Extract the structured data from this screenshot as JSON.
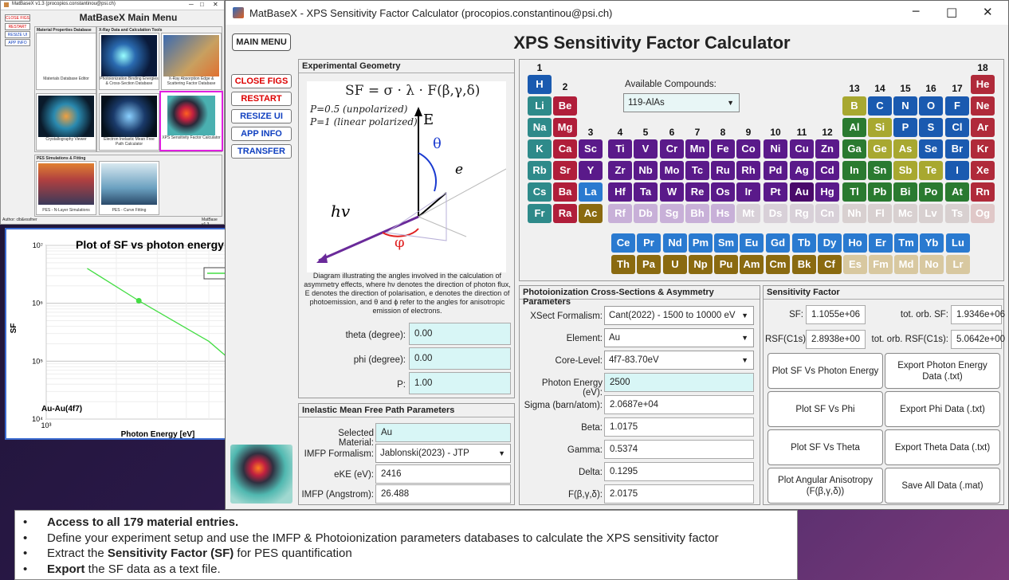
{
  "main_menu": {
    "title_bar": "MatBaseX v1.3 (procopios.constantinou@psi.ch)",
    "heading": "MatBaseX Main Menu",
    "side_buttons": [
      "CLOSE FIGS",
      "RESTART",
      "RESIZE UI",
      "APP INFO"
    ],
    "sections": [
      "Material Properties Database",
      "X-Ray Data and Calculation Tools",
      "PES Simulations & Fitting"
    ],
    "tiles": [
      "Materials Database Editor",
      "Photoionization Binding Energies & Cross-Section Database",
      "X-Ray Absorption Edge & Scattering Factor Database",
      "Crystallography Viewer",
      "Electron Inelastic Mean Free Path Calculator",
      "XPS Sensitivity Factor Calculator",
      "PES - N-Layer Simulations",
      "PES - Curve Fitting"
    ],
    "author": "Author: clb&essfner",
    "version": "MatBase v1.3"
  },
  "plot": {
    "chart_data": {
      "type": "line",
      "title": "Plot of SF vs photon energy",
      "xlabel": "Photon Energy [eV]",
      "ylabel": "SF",
      "xscale": "log",
      "yscale": "log",
      "xlim": [
        1000,
        10000
      ],
      "ylim": [
        10000,
        10000000
      ],
      "x_ticks": [
        "10³",
        "10⁴"
      ],
      "y_ticks": [
        "10⁷",
        "10⁶",
        "10⁵",
        "10⁴"
      ],
      "legend": "top-right",
      "series": [
        {
          "name": "4f7",
          "color": "#44dd44",
          "x": [
            1500,
            2500,
            5000,
            10000
          ],
          "y": [
            4000000,
            1105500,
            220000,
            20000
          ]
        }
      ],
      "marker": {
        "x": 2500,
        "y": 1105500
      },
      "annotation": "Au-Au(4f7)"
    }
  },
  "app": {
    "title_bar": "MatBaseX - XPS Sensitivity Factor Calculator (procopios.constantinou@psi.ch)",
    "title": "XPS Sensitivity Factor Calculator",
    "main_menu_btn": "MAIN MENU",
    "side_buttons": [
      "CLOSE FIGS",
      "RESTART",
      "RESIZE UI",
      "APP INFO",
      "TRANSFER"
    ],
    "geom": {
      "title": "Experimental Geometry",
      "formula": "SF = σ · λ · F(β,γ,δ)",
      "p05": "P=0.5 (unpolarized)",
      "p1": "P=1 (linear polarized)",
      "caption": "Diagram illustrating the angles involved in the calculation of asymmetry effects, where hν denotes the direction of photon flux, E denotes the direction of polarisation, e denotes the direction of photoemission, and θ and ϕ refer to the angles for anisotropic emission of electrons.",
      "diag": {
        "E": "E",
        "theta": "θ",
        "e": "e",
        "hv": "hv",
        "phi": "φ"
      },
      "theta_label": "theta (degree):",
      "theta": "0.00",
      "phi_label": "phi (degree):",
      "phi": "0.00",
      "p_label": "P:",
      "p": "1.00"
    },
    "imfp": {
      "title": "Inelastic Mean Free Path Parameters",
      "mat_label": "Selected Material:",
      "mat": "Au",
      "form_label": "IMFP Formalism:",
      "form": "Jablonski(2023) - JTP",
      "eke_label": "eKE (eV):",
      "eke": "2416",
      "imfp_label": "IMFP (Angstrom):",
      "imfp": "26.488"
    },
    "ptable": {
      "available_label": "Available Compounds:",
      "compound": "119-AlAs",
      "groups": [
        "1",
        "2",
        "3",
        "4",
        "5",
        "6",
        "7",
        "8",
        "9",
        "10",
        "11",
        "12",
        "13",
        "14",
        "15",
        "16",
        "17",
        "18"
      ]
    },
    "photo": {
      "title": "Photoionization Cross-Sections & Asymmetry Parameters",
      "rows": [
        {
          "label": "XSect Formalism:",
          "value": "Cant(2022) - 1500 to 10000 eV"
        },
        {
          "label": "Element:",
          "value": "Au"
        },
        {
          "label": "Core-Level:",
          "value": "4f7-83.70eV"
        },
        {
          "label": "Photon Energy (eV):",
          "value": "2500"
        },
        {
          "label": "Sigma (barn/atom):",
          "value": "2.0687e+04"
        },
        {
          "label": "Beta:",
          "value": "1.0175"
        },
        {
          "label": "Gamma:",
          "value": "0.5374"
        },
        {
          "label": "Delta:",
          "value": "0.1295"
        },
        {
          "label": "F(β,γ,δ):",
          "value": "2.0175"
        }
      ]
    },
    "sens": {
      "title": "Sensitivity Factor",
      "sf_label": "SF:",
      "sf": "1.1055e+06",
      "tot_sf_label": "tot. orb. SF:",
      "tot_sf": "1.9346e+06",
      "rsf_label": "RSF(C1s):",
      "rsf": "2.8938e+00",
      "tot_rsf_label": "tot. orb. RSF(C1s):",
      "tot_rsf": "5.0642e+00",
      "buttons": [
        "Plot SF Vs Photon Energy",
        "Export Photon Energy Data (.txt)",
        "Plot SF Vs Phi",
        "Export Phi Data (.txt)",
        "Plot SF Vs Theta",
        "Export Theta Data (.txt)",
        "Plot Angular Anisotropy (F(β,γ,δ))",
        "Save All Data (.mat)"
      ]
    }
  },
  "bullets": [
    {
      "bold": "Access to all 179 material entries.",
      "text": ""
    },
    {
      "bold": "",
      "text": "Define your experiment setup and use the IMFP & Photoionization parameters databases to calculate the XPS sensitivity factor"
    },
    {
      "pre": "Extract the ",
      "bold": "Sensitivity Factor (SF)",
      "text": " for PES quantification"
    },
    {
      "bold": "Export",
      "text": " the SF data as a text file."
    }
  ],
  "colors": {
    "alkali": "#2e8a8a",
    "alkaline": "#b01e3a",
    "transition": "#5a1a8a",
    "lanthanide": "#2a7ad0",
    "actinide": "#8a6a10",
    "nonmetal": "#1a5ab0",
    "noble": "#b02a3a",
    "metalloid": "#a8a830",
    "poor": "#2a7a30",
    "faded": "#c8b8d8"
  }
}
